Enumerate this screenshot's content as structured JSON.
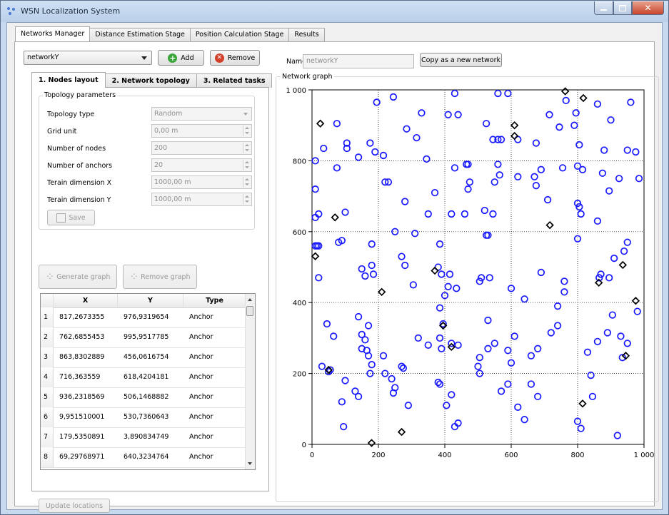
{
  "window": {
    "title": "WSN Localization System"
  },
  "outer_tabs": [
    "Networks Manager",
    "Distance Estimation Stage",
    "Position Calculation Stage",
    "Results"
  ],
  "network_select": {
    "value": "networkY"
  },
  "buttons": {
    "add": "Add",
    "remove": "Remove",
    "copy": "Copy as a new network",
    "save": "Save",
    "generate": "Generate graph",
    "remove_graph": "Remove graph",
    "update": "Update locations"
  },
  "name_field": {
    "label": "Name",
    "value": "networkY"
  },
  "inner_tabs": [
    "1. Nodes layout",
    "2. Network topology",
    "3. Related tasks"
  ],
  "topology": {
    "group_title": "Topology parameters",
    "fields": [
      {
        "label": "Topology type",
        "value": "Random",
        "kind": "combo"
      },
      {
        "label": "Grid unit",
        "value": "0,00 m",
        "kind": "spin"
      },
      {
        "label": "Number of nodes",
        "value": "200",
        "kind": "spin"
      },
      {
        "label": "Number of anchors",
        "value": "20",
        "kind": "spin"
      },
      {
        "label": "Terain dimension X",
        "value": "1000,00 m",
        "kind": "spin"
      },
      {
        "label": "Terain dimension Y",
        "value": "1000,00 m",
        "kind": "spin"
      }
    ]
  },
  "table": {
    "headers": [
      "X",
      "Y",
      "Type"
    ],
    "rows": [
      [
        "1",
        "817,2673355",
        "976,9319654",
        "Anchor"
      ],
      [
        "2",
        "762,6855453",
        "995,9517785",
        "Anchor"
      ],
      [
        "3",
        "863,8302889",
        "456,0616754",
        "Anchor"
      ],
      [
        "4",
        "716,363559",
        "618,4204181",
        "Anchor"
      ],
      [
        "5",
        "936,2318569",
        "506,1468882",
        "Anchor"
      ],
      [
        "6",
        "9,951510001",
        "530,7360643",
        "Anchor"
      ],
      [
        "7",
        "179,5350891",
        "3,890834749",
        "Anchor"
      ],
      [
        "8",
        "69,29768971",
        "640,3234764",
        "Anchor"
      ]
    ]
  },
  "graph": {
    "title": "Network graph"
  },
  "colors": {
    "node": "#1a1aff",
    "anchor": "#000000",
    "accent_add": "#3aa53a",
    "accent_remove": "#d2402a"
  },
  "chart_data": {
    "type": "scatter",
    "title": "",
    "xlabel": "",
    "ylabel": "",
    "xlim": [
      0,
      1000
    ],
    "ylim": [
      0,
      1000
    ],
    "xticks": [
      "0",
      "200",
      "400",
      "600",
      "800",
      "1 000"
    ],
    "yticks": [
      "0",
      "200",
      "400",
      "600",
      "800",
      "1 000"
    ],
    "grid": true,
    "series": [
      {
        "marker": "circle",
        "color": "#1a1aff",
        "points": [
          [
            20,
            470
          ],
          [
            15,
            560
          ],
          [
            10,
            640
          ],
          [
            10,
            720
          ],
          [
            10,
            800
          ],
          [
            35,
            835
          ],
          [
            75,
            905
          ],
          [
            105,
            850
          ],
          [
            105,
            835
          ],
          [
            140,
            810
          ],
          [
            175,
            850
          ],
          [
            190,
            825
          ],
          [
            215,
            815
          ],
          [
            195,
            965
          ],
          [
            245,
            980
          ],
          [
            285,
            890
          ],
          [
            315,
            865
          ],
          [
            330,
            935
          ],
          [
            345,
            805
          ],
          [
            410,
            930
          ],
          [
            440,
            930
          ],
          [
            430,
            990
          ],
          [
            525,
            905
          ],
          [
            545,
            860
          ],
          [
            560,
            860
          ],
          [
            570,
            860
          ],
          [
            560,
            990
          ],
          [
            590,
            990
          ],
          [
            620,
            860
          ],
          [
            675,
            850
          ],
          [
            715,
            930
          ],
          [
            745,
            895
          ],
          [
            795,
            935
          ],
          [
            790,
            900
          ],
          [
            805,
            845
          ],
          [
            765,
            970
          ],
          [
            860,
            960
          ],
          [
            900,
            915
          ],
          [
            950,
            830
          ],
          [
            975,
            825
          ],
          [
            985,
            750
          ],
          [
            960,
            965
          ],
          [
            925,
            750
          ],
          [
            895,
            715
          ],
          [
            875,
            765
          ],
          [
            880,
            830
          ],
          [
            800,
            785
          ],
          [
            815,
            775
          ],
          [
            755,
            780
          ],
          [
            690,
            775
          ],
          [
            675,
            730
          ],
          [
            710,
            690
          ],
          [
            670,
            755
          ],
          [
            620,
            755
          ],
          [
            565,
            760
          ],
          [
            550,
            740
          ],
          [
            560,
            790
          ],
          [
            470,
            790
          ],
          [
            465,
            790
          ],
          [
            475,
            740
          ],
          [
            470,
            720
          ],
          [
            430,
            780
          ],
          [
            370,
            710
          ],
          [
            280,
            685
          ],
          [
            230,
            740
          ],
          [
            220,
            740
          ],
          [
            75,
            780
          ],
          [
            100,
            655
          ],
          [
            20,
            650
          ],
          [
            350,
            650
          ],
          [
            420,
            650
          ],
          [
            460,
            650
          ],
          [
            520,
            660
          ],
          [
            545,
            650
          ],
          [
            525,
            590
          ],
          [
            530,
            590
          ],
          [
            310,
            595
          ],
          [
            250,
            600
          ],
          [
            180,
            565
          ],
          [
            80,
            570
          ],
          [
            90,
            575
          ],
          [
            20,
            560
          ],
          [
            10,
            560
          ],
          [
            150,
            495
          ],
          [
            160,
            475
          ],
          [
            180,
            505
          ],
          [
            185,
            480
          ],
          [
            270,
            530
          ],
          [
            280,
            505
          ],
          [
            305,
            450
          ],
          [
            385,
            565
          ],
          [
            380,
            500
          ],
          [
            390,
            480
          ],
          [
            415,
            480
          ],
          [
            400,
            420
          ],
          [
            410,
            445
          ],
          [
            435,
            440
          ],
          [
            510,
            470
          ],
          [
            535,
            470
          ],
          [
            505,
            460
          ],
          [
            600,
            440
          ],
          [
            640,
            410
          ],
          [
            690,
            485
          ],
          [
            760,
            460
          ],
          [
            760,
            430
          ],
          [
            740,
            390
          ],
          [
            800,
            580
          ],
          [
            810,
            650
          ],
          [
            805,
            670
          ],
          [
            800,
            680
          ],
          [
            860,
            630
          ],
          [
            950,
            570
          ],
          [
            940,
            545
          ],
          [
            910,
            525
          ],
          [
            870,
            480
          ],
          [
            865,
            470
          ],
          [
            895,
            470
          ],
          [
            980,
            375
          ],
          [
            950,
            285
          ],
          [
            930,
            305
          ],
          [
            935,
            245
          ],
          [
            905,
            365
          ],
          [
            890,
            315
          ],
          [
            860,
            290
          ],
          [
            830,
            260
          ],
          [
            840,
            195
          ],
          [
            845,
            135
          ],
          [
            800,
            65
          ],
          [
            810,
            45
          ],
          [
            920,
            25
          ],
          [
            680,
            135
          ],
          [
            660,
            170
          ],
          [
            620,
            105
          ],
          [
            640,
            70
          ],
          [
            570,
            150
          ],
          [
            590,
            170
          ],
          [
            600,
            230
          ],
          [
            590,
            265
          ],
          [
            610,
            305
          ],
          [
            660,
            250
          ],
          [
            680,
            270
          ],
          [
            720,
            315
          ],
          [
            740,
            335
          ],
          [
            550,
            285
          ],
          [
            530,
            270
          ],
          [
            505,
            200
          ],
          [
            505,
            245
          ],
          [
            500,
            220
          ],
          [
            530,
            350
          ],
          [
            440,
            280
          ],
          [
            420,
            285
          ],
          [
            395,
            340
          ],
          [
            385,
            300
          ],
          [
            390,
            270
          ],
          [
            350,
            280
          ],
          [
            320,
            300
          ],
          [
            385,
            385
          ],
          [
            385,
            170
          ],
          [
            405,
            110
          ],
          [
            420,
            140
          ],
          [
            440,
            60
          ],
          [
            430,
            50
          ],
          [
            270,
            220
          ],
          [
            275,
            215
          ],
          [
            240,
            185
          ],
          [
            250,
            160
          ],
          [
            245,
            145
          ],
          [
            220,
            200
          ],
          [
            215,
            250
          ],
          [
            180,
            225
          ],
          [
            175,
            200
          ],
          [
            170,
            250
          ],
          [
            165,
            265
          ],
          [
            160,
            295
          ],
          [
            170,
            335
          ],
          [
            150,
            310
          ],
          [
            140,
            360
          ],
          [
            130,
            150
          ],
          [
            140,
            135
          ],
          [
            100,
            180
          ],
          [
            90,
            120
          ],
          [
            95,
            50
          ],
          [
            65,
            305
          ],
          [
            45,
            340
          ],
          [
            50,
            205
          ],
          [
            55,
            210
          ],
          [
            30,
            220
          ],
          [
            290,
            110
          ],
          [
            380,
            175
          ],
          [
            150,
            270
          ]
        ]
      },
      {
        "marker": "diamond",
        "color": "#000000",
        "points": [
          [
            817.3,
            976.9
          ],
          [
            762.7,
            995.95
          ],
          [
            863.8,
            456.1
          ],
          [
            716.4,
            618.4
          ],
          [
            936.2,
            506.1
          ],
          [
            9.95,
            530.7
          ],
          [
            179.5,
            3.9
          ],
          [
            69.3,
            640.3
          ],
          [
            25,
            905
          ],
          [
            610,
            900
          ],
          [
            610,
            870
          ],
          [
            210,
            430
          ],
          [
            370,
            490
          ],
          [
            395,
            335
          ],
          [
            420,
            275
          ],
          [
            815,
            115
          ],
          [
            270,
            35
          ],
          [
            50,
            210
          ],
          [
            975,
            405
          ],
          [
            945,
            250
          ]
        ]
      }
    ]
  }
}
